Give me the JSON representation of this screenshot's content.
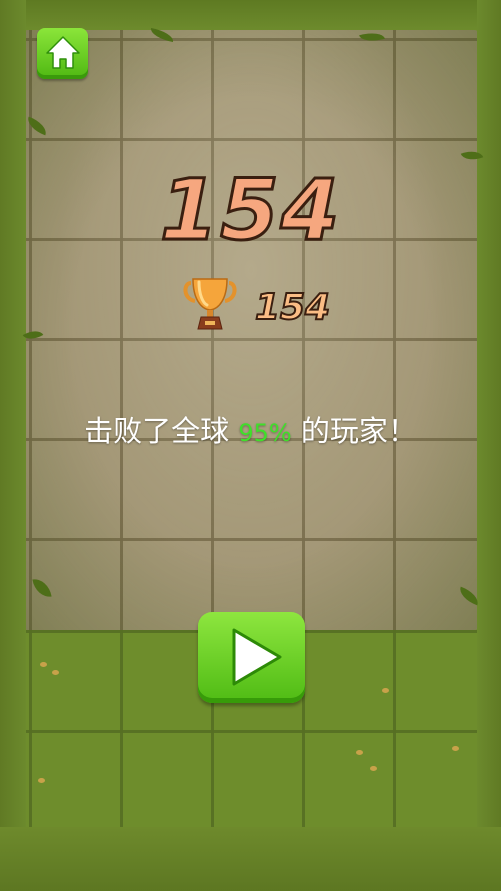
{
  "score": "154",
  "best": {
    "value": "154",
    "icon": "trophy-icon"
  },
  "result": {
    "prefix": "击败了全球 ",
    "percent": "95%",
    "suffix": " 的玩家！"
  },
  "buttons": {
    "home_icon": "home-icon",
    "play_icon": "play-icon"
  },
  "colors": {
    "score": "#f6a77f",
    "percent": "#3fe02a",
    "button_green": "#5fc71e"
  }
}
